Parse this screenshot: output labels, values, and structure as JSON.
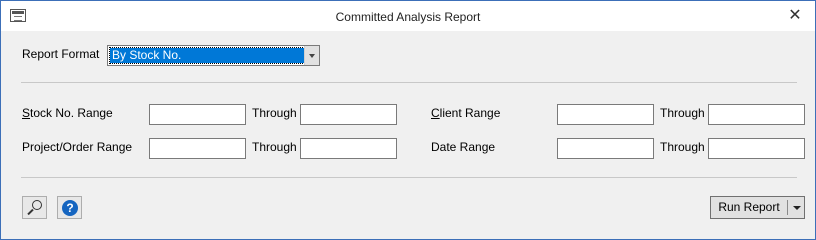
{
  "window": {
    "title": "Committed Analysis Report",
    "close_glyph": "✕"
  },
  "report_format": {
    "label": "Report Format",
    "selected": "By Stock No."
  },
  "fields": {
    "stock_range": {
      "label": "Stock No. Range",
      "access_key": "S",
      "rest": "tock No. Range",
      "from": "",
      "through_label": "Through",
      "to": ""
    },
    "project_range": {
      "label": "Project/Order Range",
      "from": "",
      "through_label": "Through",
      "to": ""
    },
    "client_range": {
      "label": "Client Range",
      "access_key": "C",
      "rest": "lient Range",
      "from": "",
      "through_label": "Through",
      "to": ""
    },
    "date_range": {
      "label": "Date Range",
      "from": "",
      "through_label": "Through",
      "to": ""
    }
  },
  "footer": {
    "preview_icon": "magnifier-icon",
    "help_glyph": "?",
    "run_label": "Run Report"
  }
}
